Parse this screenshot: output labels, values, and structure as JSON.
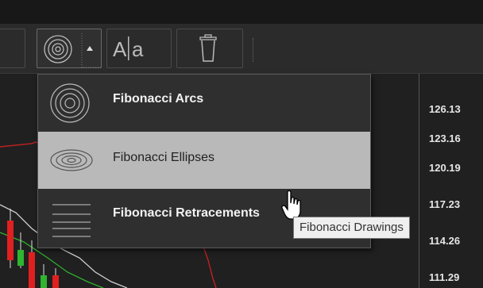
{
  "toolbar": {
    "buttons": [
      {
        "name": "fibonacci-tools-button",
        "icon": "concentric-circles-icon"
      },
      {
        "name": "text-tool-button",
        "icon": "text-label-icon"
      },
      {
        "name": "delete-drawings-button",
        "icon": "trash-icon"
      }
    ]
  },
  "menu": {
    "items": [
      {
        "label": "Fibonacci Arcs",
        "icon": "fibonacci-arcs-icon"
      },
      {
        "label": "Fibonacci Ellipses",
        "icon": "fibonacci-ellipses-icon"
      },
      {
        "label": "Fibonacci Retracements",
        "icon": "fibonacci-retracements-icon"
      }
    ],
    "hover_index": 1
  },
  "tooltip": {
    "text": "Fibonacci Drawings"
  },
  "price_axis": [
    "126.13",
    "123.16",
    "120.19",
    "117.23",
    "114.26",
    "111.29"
  ],
  "colors": {
    "menu_bg": "#2f2f2f",
    "menu_hover": "#b9b9b9",
    "up_candle": "#2fb52f",
    "down_candle": "#e02020"
  }
}
